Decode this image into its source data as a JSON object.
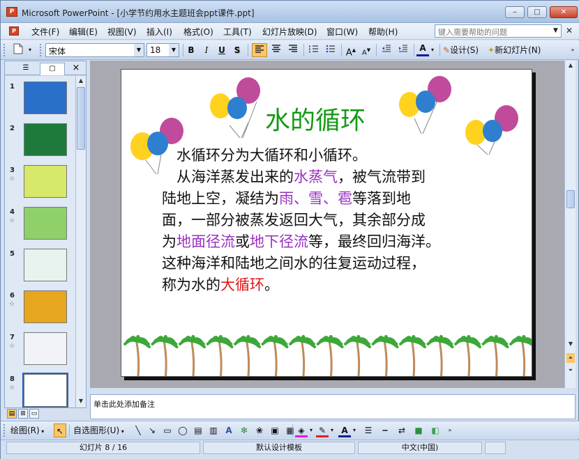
{
  "window": {
    "title": "Microsoft PowerPoint - [小学节约用水主题班会ppt课件.ppt]",
    "app_icon": "P",
    "min_glyph": "‒",
    "max_glyph": "□",
    "close_glyph": "✕"
  },
  "menubar": {
    "items": [
      "文件(F)",
      "编辑(E)",
      "视图(V)",
      "插入(I)",
      "格式(O)",
      "工具(T)",
      "幻灯片放映(D)",
      "窗口(W)",
      "帮助(H)"
    ],
    "help_placeholder": "键入需要帮助的问题"
  },
  "toolbar": {
    "font_name": "宋体",
    "font_size": "18",
    "bold": "B",
    "italic": "I",
    "underline": "U",
    "shadow": "S",
    "design_label": "设计(S)",
    "new_slide_label": "新幻灯片(N)"
  },
  "slide_pane": {
    "tab_outline": "☰",
    "tab_slides": "▢",
    "close": "×",
    "thumbnails": [
      {
        "num": "1",
        "star": false,
        "bg": "#2a6fc9"
      },
      {
        "num": "2",
        "star": false,
        "bg": "#1e7a3a"
      },
      {
        "num": "3",
        "star": true,
        "bg": "#d8e86a"
      },
      {
        "num": "4",
        "star": true,
        "bg": "#8fd06b"
      },
      {
        "num": "5",
        "star": false,
        "bg": "#e8f3ef"
      },
      {
        "num": "6",
        "star": true,
        "bg": "#e6a61e"
      },
      {
        "num": "7",
        "star": true,
        "bg": "#f1f3f8"
      },
      {
        "num": "8",
        "star": true,
        "bg": "#ffffff"
      }
    ]
  },
  "slide": {
    "title": "水的循环",
    "lines": [
      [
        {
          "t": "　水循环分为大循环和小循环。",
          "c": ""
        }
      ],
      [
        {
          "t": "　从海洋蒸发出来的",
          "c": ""
        },
        {
          "t": "水蒸气",
          "c": "purple"
        },
        {
          "t": "，被气流带到",
          "c": ""
        }
      ],
      [
        {
          "t": "陆地上空，凝结为",
          "c": ""
        },
        {
          "t": "雨、雪、雹",
          "c": "purple"
        },
        {
          "t": "等落到地",
          "c": ""
        }
      ],
      [
        {
          "t": "面，一部分被蒸发返回大气，其余部分成",
          "c": ""
        }
      ],
      [
        {
          "t": "为",
          "c": ""
        },
        {
          "t": "地面径流",
          "c": "purple"
        },
        {
          "t": "或",
          "c": ""
        },
        {
          "t": "地下径流",
          "c": "purple"
        },
        {
          "t": "等，最终回归海洋。",
          "c": ""
        }
      ],
      [
        {
          "t": "这种海洋和陆地之间水的往复运动过程，",
          "c": ""
        }
      ],
      [
        {
          "t": "称为水的",
          "c": ""
        },
        {
          "t": "大循环",
          "c": "red"
        },
        {
          "t": "。",
          "c": ""
        }
      ]
    ]
  },
  "notes": {
    "placeholder": "单击此处添加备注"
  },
  "drawing": {
    "draw_label": "绘图(R)",
    "autoshapes_label": "自选图形(U)"
  },
  "status": {
    "slide_indicator": "幻灯片 8 / 16",
    "template": "默认设计模板",
    "language": "中文(中国)"
  }
}
